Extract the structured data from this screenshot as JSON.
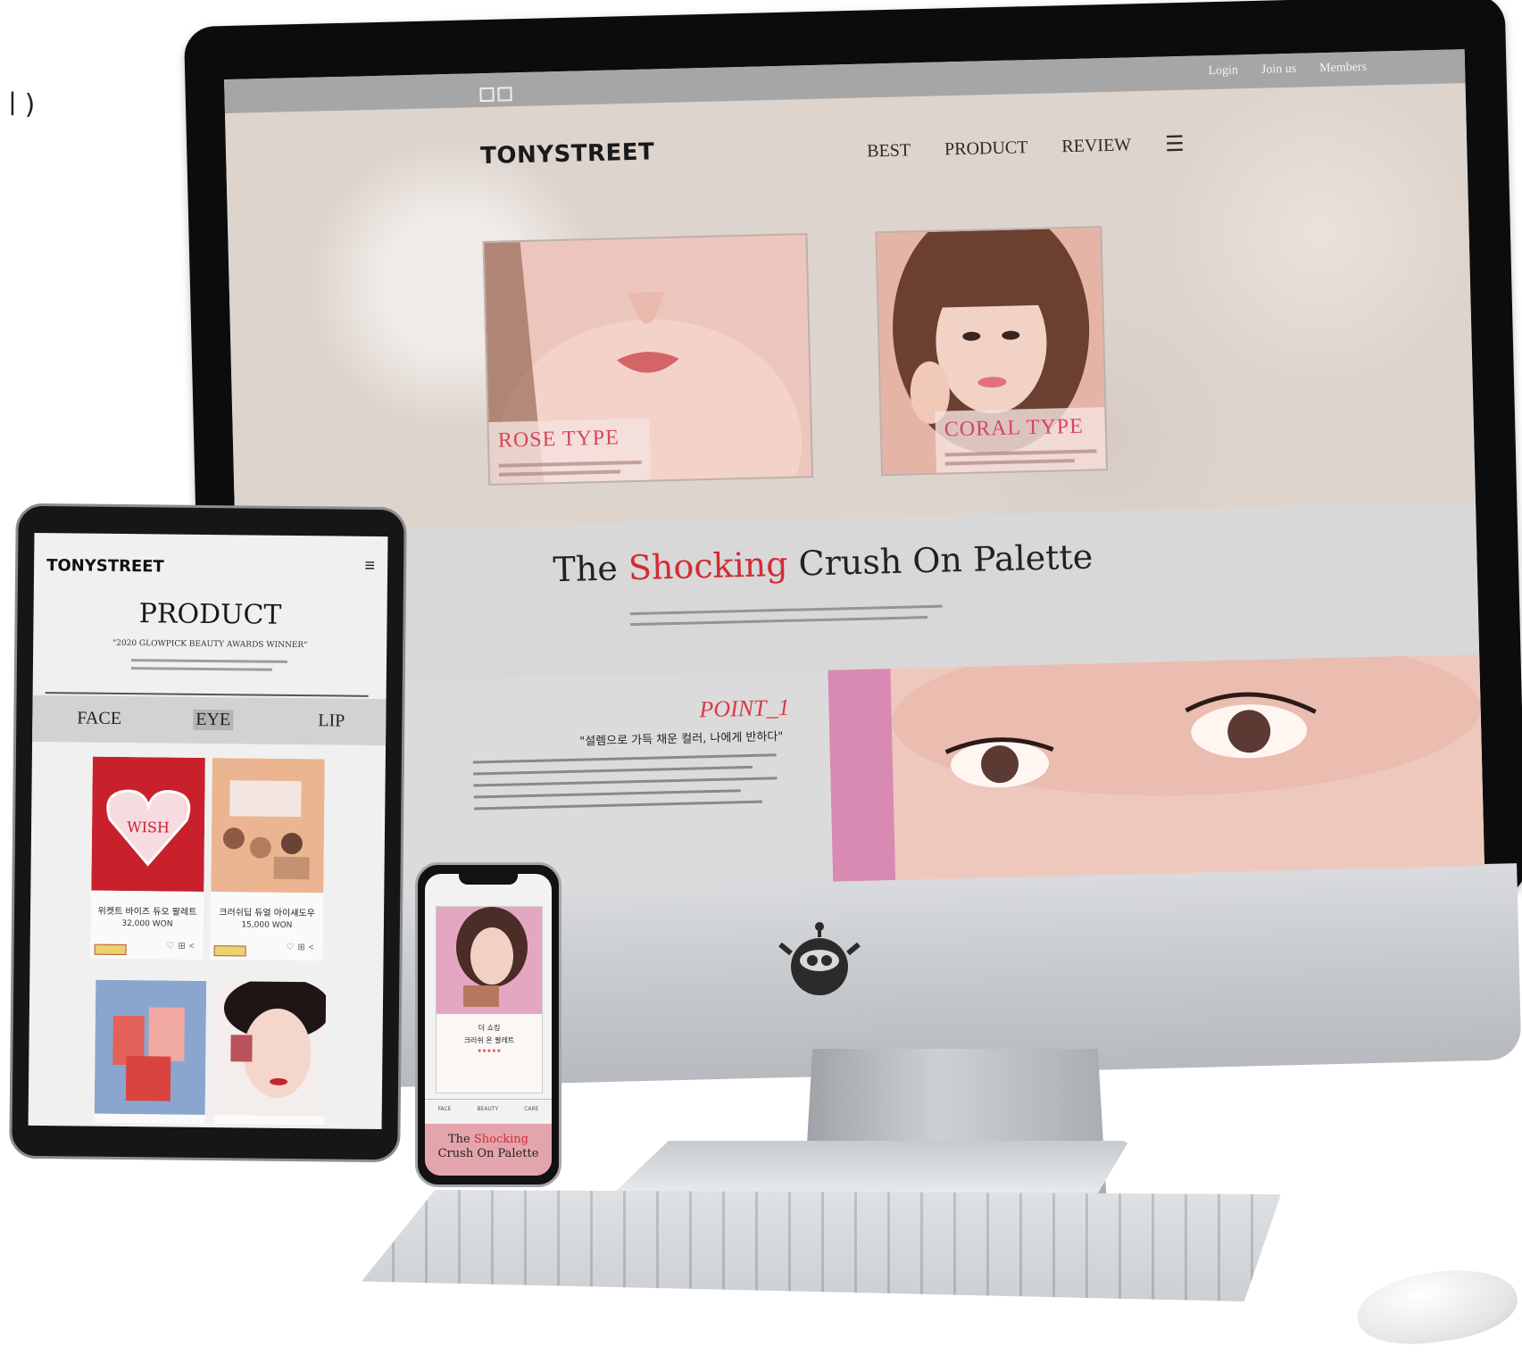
{
  "page_fragment": "ㅣ)",
  "desktop": {
    "top_links": [
      "Login",
      "Join us",
      "Members"
    ],
    "logo": "TONYSTREET",
    "nav": [
      "BEST",
      "PRODUCT",
      "REVIEW"
    ],
    "menu_icon": "☰",
    "cards": [
      {
        "title": "ROSE TYPE"
      },
      {
        "title": "CORAL TYPE"
      }
    ],
    "palette_title": {
      "pre": "The ",
      "highlight": "Shocking",
      "post": " Crush On Palette"
    },
    "point": {
      "title": "POINT_1",
      "subtitle": "\"설렘으로 가득 채운 컬러, 나에게 반하다\""
    },
    "accent_color": "#d32a35"
  },
  "tablet": {
    "logo": "TONYSTREET",
    "menu_icon": "≡",
    "heading": "PRODUCT",
    "quote": "\"2020 GLOWPICK BEAUTY AWARDS WINNER\"",
    "tabs": [
      "FACE",
      "EYE",
      "LIP"
    ],
    "active_tab": "EYE",
    "products": [
      {
        "name": "위켓트 바이즈 듀오 팔레트",
        "price": "32,000 WON"
      },
      {
        "name": "크러쉬딥 듀얼 아이섀도우",
        "price": "15,000 WON"
      }
    ],
    "wish_label": "WISH"
  },
  "phone": {
    "line1": "더 쇼킹",
    "line2": "크러쉬 온 팔레트",
    "stars": "★★★★★",
    "tabs": [
      "FACE",
      "BEAUTY",
      "CARE"
    ],
    "band": {
      "pre": "The ",
      "highlight": "Shocking",
      "post": "Crush On Palette"
    }
  }
}
